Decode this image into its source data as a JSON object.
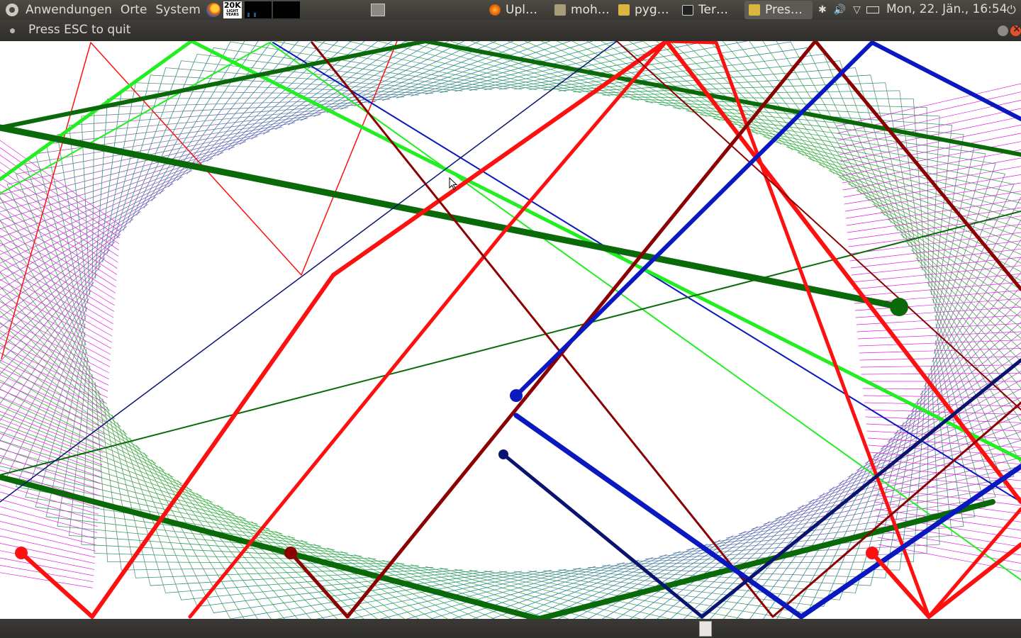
{
  "top_panel": {
    "menus": [
      "Anwendungen",
      "Orte",
      "System"
    ],
    "launcher_badge": "20K",
    "launcher_badge_sub": "LIGHT YEARS",
    "tasks": [
      {
        "label": "Upl…",
        "icon": "firefox-icon"
      },
      {
        "label": "moh…",
        "icon": "folder-icon"
      },
      {
        "label": "pyg…",
        "icon": "python-icon"
      },
      {
        "label": "Ter…",
        "icon": "terminal-icon"
      },
      {
        "label": "Pres…",
        "icon": "python-icon"
      }
    ],
    "tray_icons": [
      "bluetooth-icon",
      "volume-icon",
      "wifi-icon",
      "battery-icon"
    ],
    "clock": "Mon, 22. Jän., 16:54",
    "power_icon": "power-icon"
  },
  "window": {
    "title": "Press ESC to quit"
  },
  "colors": {
    "panel_bg": "#3c3b37",
    "mesh_green": "#2fa02f",
    "bright_green": "#22ee22",
    "dark_green": "#0a6a0a",
    "red": "#ff1010",
    "dark_red": "#8b0000",
    "blue": "#0a18c0",
    "navy": "#0a1470",
    "magenta": "#e020e0"
  }
}
